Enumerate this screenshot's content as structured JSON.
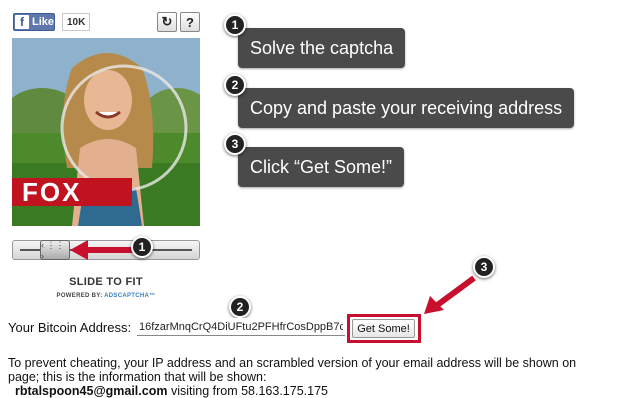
{
  "facebook": {
    "like_label": "Like",
    "like_count": "10K",
    "icon": "facebook-f-icon"
  },
  "captcha_tools": {
    "refresh_icon": "refresh-icon",
    "help_label": "?"
  },
  "captcha": {
    "banner_text": "FOX",
    "slider_label": "SLIDE TO FIT",
    "powered_prefix": "POWERED BY:",
    "powered_brand": "ADSCAPTCHA™"
  },
  "callouts": [
    {
      "number": "1",
      "text": "Solve the captcha"
    },
    {
      "number": "2",
      "text": "Copy and paste your receiving address"
    },
    {
      "number": "3",
      "text": "Click “Get Some!”"
    }
  ],
  "markers": {
    "slider": "1",
    "address": "2",
    "button": "3"
  },
  "address_form": {
    "label": "Your Bitcoin Address:",
    "value": "16fzarMnqCrQ4DiUFtu2PFHfrCosDppB7c",
    "submit_label": "Get Some!"
  },
  "info": {
    "line1": "To prevent cheating, your IP address and an scrambled version of your email address will be shown on",
    "line2": "page; this is the information that will be shown:",
    "email": "rbtalspoon45@gmail.com",
    "visiting": "visiting from 58.163.175.175"
  },
  "colors": {
    "highlight_red": "#c8102e",
    "callout_bg": "#4a4a4a",
    "fb_blue": "#5f78ab"
  }
}
